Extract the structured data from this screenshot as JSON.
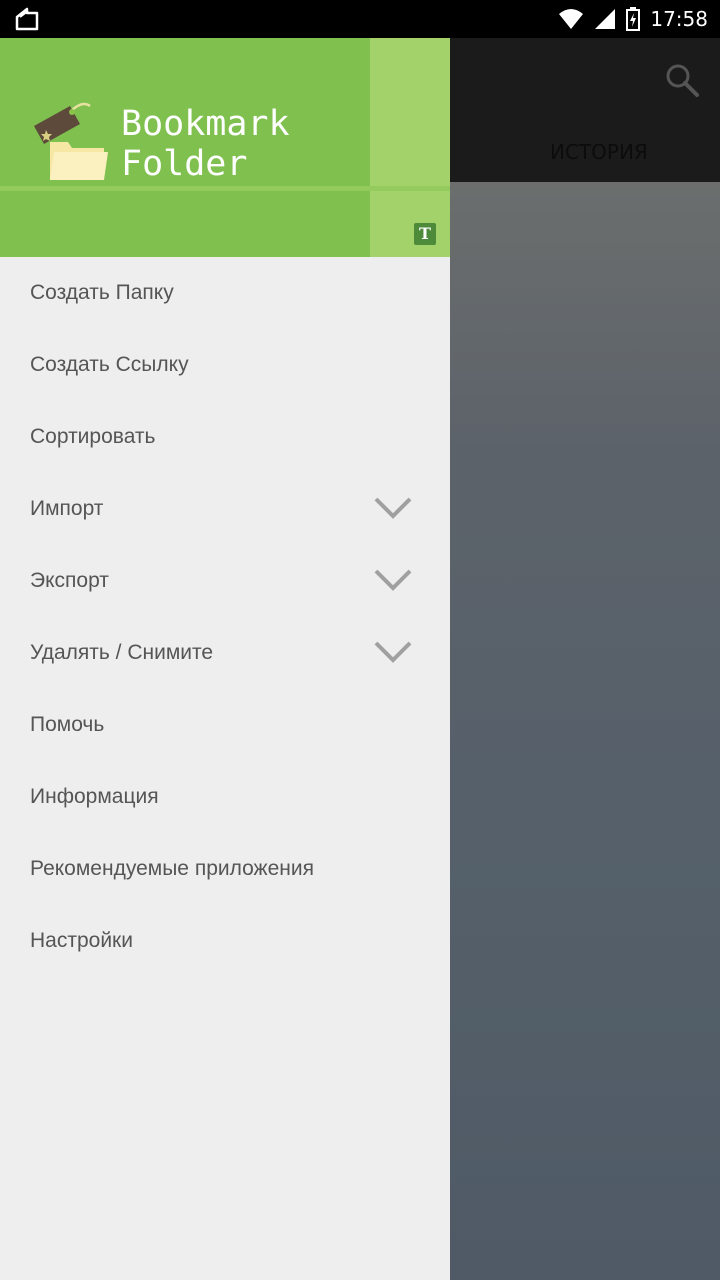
{
  "status_bar": {
    "time": "17:58"
  },
  "app": {
    "tab_history": "ИСТОРИЯ",
    "search_icon": "search-icon"
  },
  "drawer": {
    "title_line1": "Bookmark",
    "title_line2": "Folder",
    "badge": "T",
    "colors": {
      "header": "#7fc04f",
      "stripe": "#a3d16a",
      "menu_bg": "#eeeeee"
    },
    "items": [
      {
        "label": "Создать Папку",
        "expandable": false
      },
      {
        "label": "Создать Ссылку",
        "expandable": false
      },
      {
        "label": "Сортировать",
        "expandable": false
      },
      {
        "label": "Импорт",
        "expandable": true
      },
      {
        "label": "Экспорт",
        "expandable": true
      },
      {
        "label": "Удалять / Снимите",
        "expandable": true
      },
      {
        "label": "Помочь",
        "expandable": false
      },
      {
        "label": "Информация",
        "expandable": false
      },
      {
        "label": "Рекомендуемые приложения",
        "expandable": false
      },
      {
        "label": "Настройки",
        "expandable": false
      }
    ]
  }
}
